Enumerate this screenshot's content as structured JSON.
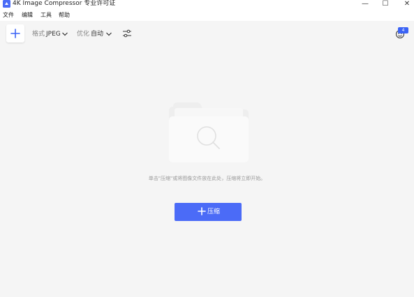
{
  "window": {
    "title": "4K Image Compressor 专业许可证",
    "controls": {
      "minimize": "—",
      "maximize": "☐",
      "close": "✕"
    }
  },
  "menu": {
    "items": [
      {
        "label": "文件"
      },
      {
        "label": "编辑"
      },
      {
        "label": "工具"
      },
      {
        "label": "帮助"
      }
    ]
  },
  "toolbar": {
    "add_icon": "plus-icon",
    "format_label": "格式",
    "format_value": "JPEG",
    "optimize_label": "优化",
    "optimize_value": "自动",
    "settings_icon": "sliders-icon",
    "account_icon": "account-icon",
    "notification_count": "4"
  },
  "main": {
    "illustration_icon": "folder-search-icon",
    "hint": "单击\"压缩\"或将图像文件放在此处，压缩将立即开始。",
    "compress_button_label": "压缩"
  },
  "colors": {
    "accent": "#4b6bf7",
    "background": "#f5f5f5"
  }
}
